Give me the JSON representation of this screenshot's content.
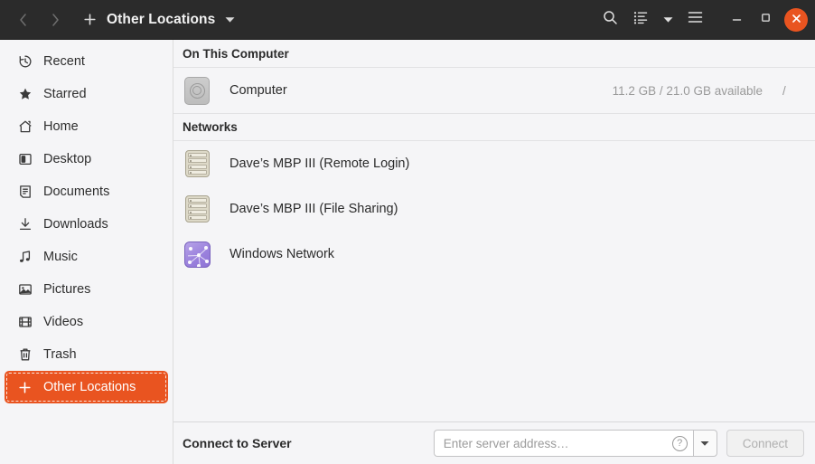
{
  "header": {
    "title": "Other Locations",
    "back_icon": "chevron-left-icon",
    "forward_icon": "chevron-right-icon",
    "new_tab_icon": "plus-icon",
    "title_caret_icon": "chevron-down-icon",
    "search_icon": "search-icon",
    "view_list_icon": "list-view-icon",
    "view_caret_icon": "chevron-down-icon",
    "menu_icon": "hamburger-menu-icon",
    "minimize_label": "–",
    "maximize_label": "□",
    "close_label": "×",
    "accent_color": "#e95420",
    "bar_color": "#2b2b2b"
  },
  "sidebar": {
    "items": [
      {
        "label": "Recent",
        "icon": "clock-icon",
        "selected": false
      },
      {
        "label": "Starred",
        "icon": "star-icon",
        "selected": false
      },
      {
        "label": "Home",
        "icon": "home-icon",
        "selected": false
      },
      {
        "label": "Desktop",
        "icon": "desktop-icon",
        "selected": false
      },
      {
        "label": "Documents",
        "icon": "document-icon",
        "selected": false
      },
      {
        "label": "Downloads",
        "icon": "download-icon",
        "selected": false
      },
      {
        "label": "Music",
        "icon": "music-icon",
        "selected": false
      },
      {
        "label": "Pictures",
        "icon": "picture-icon",
        "selected": false
      },
      {
        "label": "Videos",
        "icon": "video-icon",
        "selected": false
      },
      {
        "label": "Trash",
        "icon": "trash-icon",
        "selected": false
      },
      {
        "label": "Other Locations",
        "icon": "plus-icon",
        "selected": true
      }
    ]
  },
  "main": {
    "sections": [
      {
        "title": "On This Computer",
        "rows": [
          {
            "name": "Computer",
            "icon": "drive-icon",
            "meta": "11.2 GB / 21.0 GB available",
            "path": "/"
          }
        ]
      },
      {
        "title": "Networks",
        "rows": [
          {
            "name": "Dave’s MBP III (Remote Login)",
            "icon": "server-icon",
            "meta": "",
            "path": ""
          },
          {
            "name": "Dave’s MBP III (File Sharing)",
            "icon": "server-icon",
            "meta": "",
            "path": ""
          },
          {
            "name": "Windows Network",
            "icon": "network-icon",
            "meta": "",
            "path": ""
          }
        ]
      }
    ]
  },
  "connect": {
    "label": "Connect to Server",
    "placeholder": "Enter server address…",
    "value": "",
    "help_icon": "help-circle-icon",
    "dropdown_icon": "chevron-down-icon",
    "button_label": "Connect",
    "button_enabled": false
  }
}
